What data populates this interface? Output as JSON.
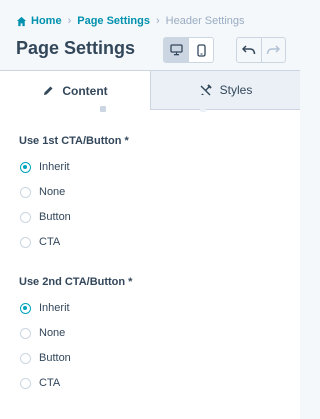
{
  "breadcrumb": {
    "home": "Home",
    "page_settings": "Page Settings",
    "current": "Header Settings"
  },
  "header": {
    "title": "Page Settings"
  },
  "tabs": {
    "content": "Content",
    "styles": "Styles"
  },
  "cta1": {
    "label": "Use 1st CTA/Button *",
    "options": [
      "Inherit",
      "None",
      "Button",
      "CTA"
    ],
    "selected": "Inherit"
  },
  "cta2": {
    "label": "Use 2nd CTA/Button *",
    "options": [
      "Inherit",
      "None",
      "Button",
      "CTA"
    ],
    "selected": "Inherit"
  },
  "icons": {
    "home": "home-icon",
    "desktop": "desktop-icon",
    "mobile": "mobile-icon",
    "undo": "undo-icon",
    "redo": "redo-icon",
    "content": "pencil-icon",
    "styles": "paintbrush-icon"
  },
  "colors": {
    "accent": "#00a4bd",
    "link": "#0091ae",
    "text": "#33475b",
    "border": "#cbd6e2",
    "muted": "#99acc2"
  }
}
